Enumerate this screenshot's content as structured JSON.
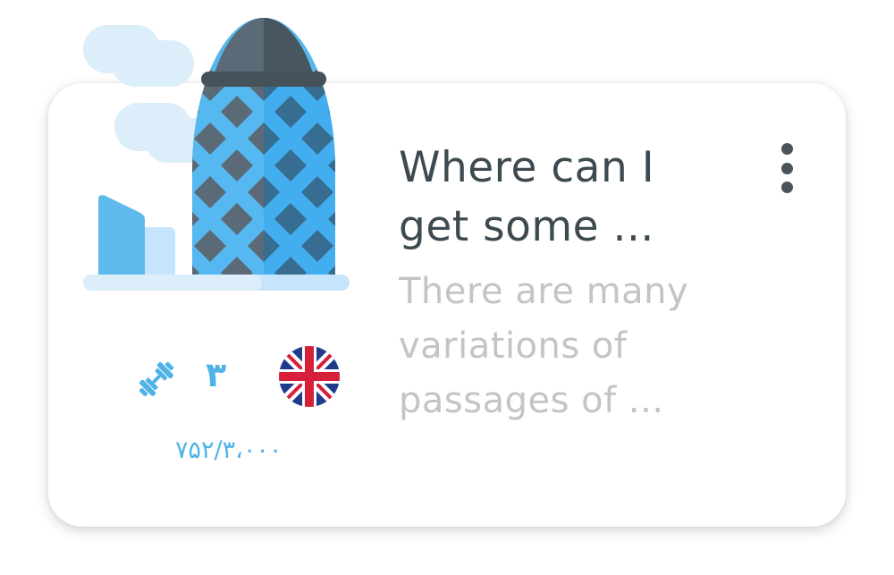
{
  "card": {
    "title": "Where can I get some ...",
    "description": "There are many variations of passages of ...",
    "level": "۳",
    "price": "۷۵۲/۳،۰۰۰"
  },
  "icons": {
    "illustration": "gherkin-building-illustration",
    "menu": "more-vertical-icon",
    "difficulty": "dumbbell-icon",
    "language": "uk-flag-icon"
  },
  "colors": {
    "accent": "#4fb3e8",
    "title": "#3d4a4f",
    "description": "#c4c4c4"
  }
}
